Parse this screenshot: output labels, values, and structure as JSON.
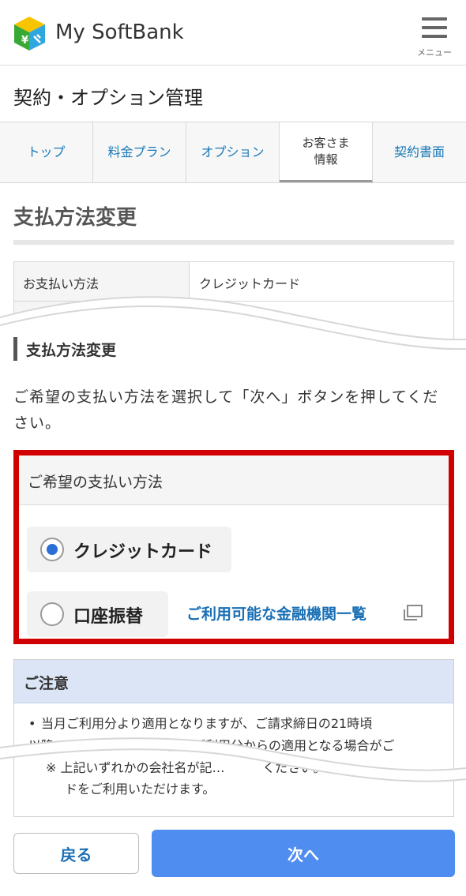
{
  "header": {
    "brand": "My SoftBank",
    "menu_label": "メニュー"
  },
  "page_title": "契約・オプション管理",
  "tabs": [
    {
      "label": "トップ",
      "active": false
    },
    {
      "label": "料金プラン",
      "active": false
    },
    {
      "label": "オプション",
      "active": false
    },
    {
      "label": "お客さま\n情報",
      "active": true
    },
    {
      "label": "契約書面",
      "active": false
    }
  ],
  "section_title": "支払方法変更",
  "current_info": {
    "rows": [
      {
        "key": "お支払い方法",
        "value": "クレジットカード"
      },
      {
        "key": "",
        "value": ""
      }
    ]
  },
  "subsection_title": "支払方法変更",
  "instruction": "ご希望の支払い方法を選択して「次へ」ボタンを押してください。",
  "payment_choice": {
    "heading": "ご希望の支払い方法",
    "options": [
      {
        "label": "クレジットカード",
        "selected": true
      },
      {
        "label": "口座振替",
        "selected": false
      }
    ],
    "bank_link": "ご利用可能な金融機関一覧",
    "highlight_color": "#d10000"
  },
  "notice": {
    "heading": "ご注意",
    "bullet_line1": "当月ご利用分より適用となりますが、ご請求締日の21時頃",
    "bullet_line2": "以降…　　　　　　　　翌月ご利用分からの適用となる場合がご",
    "note_line1": "※ 上記いずれかの会社名が記…　　　ください。",
    "note_line2": "ドをご利用いただけます。"
  },
  "buttons": {
    "back": "戻る",
    "next": "次へ"
  },
  "colors": {
    "link": "#1a6fb5",
    "primary_button": "#4f8df0",
    "notice_header": "#dbe5f6"
  }
}
